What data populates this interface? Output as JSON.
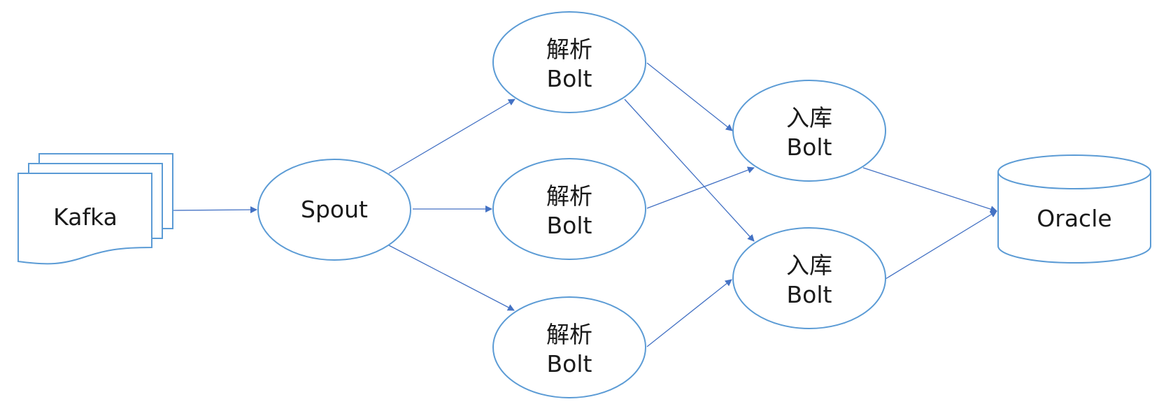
{
  "colors": {
    "node_stroke": "#5b9bd5",
    "edge": "#4472c4",
    "text": "#1a1a1a"
  },
  "nodes": {
    "kafka": {
      "label": "Kafka",
      "shape": "multi-document"
    },
    "spout": {
      "label": "Spout",
      "shape": "ellipse"
    },
    "parse_bolt_1": {
      "line1": "解析",
      "line2": "Bolt",
      "shape": "ellipse"
    },
    "parse_bolt_2": {
      "line1": "解析",
      "line2": "Bolt",
      "shape": "ellipse"
    },
    "parse_bolt_3": {
      "line1": "解析",
      "line2": "Bolt",
      "shape": "ellipse"
    },
    "store_bolt_1": {
      "line1": "入库",
      "line2": "Bolt",
      "shape": "ellipse"
    },
    "store_bolt_2": {
      "line1": "入库",
      "line2": "Bolt",
      "shape": "ellipse"
    },
    "oracle": {
      "label": "Oracle",
      "shape": "database-cylinder"
    }
  },
  "edges": [
    {
      "from": "kafka",
      "to": "spout"
    },
    {
      "from": "spout",
      "to": "parse_bolt_1"
    },
    {
      "from": "spout",
      "to": "parse_bolt_2"
    },
    {
      "from": "spout",
      "to": "parse_bolt_3"
    },
    {
      "from": "parse_bolt_1",
      "to": "store_bolt_1"
    },
    {
      "from": "parse_bolt_1",
      "to": "store_bolt_2"
    },
    {
      "from": "parse_bolt_2",
      "to": "store_bolt_1"
    },
    {
      "from": "parse_bolt_3",
      "to": "store_bolt_2"
    },
    {
      "from": "store_bolt_1",
      "to": "oracle"
    },
    {
      "from": "store_bolt_2",
      "to": "oracle"
    }
  ]
}
